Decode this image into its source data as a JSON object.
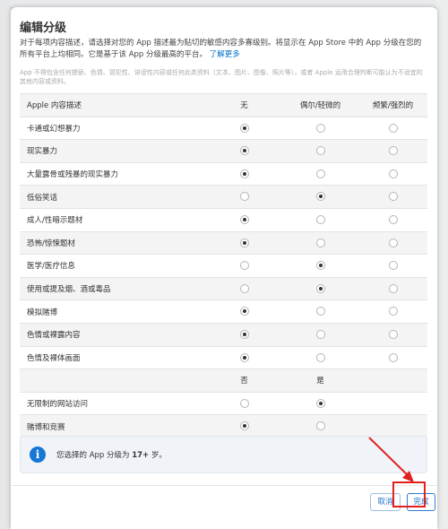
{
  "dialog": {
    "title": "编辑分级",
    "description": "对于每项内容描述，请选择对您的 App 描述最为贴切的敏感内容多寡级别。将显示在 App Store 中的 App 分级在您的所有平台上均相同。它是基于该 App 分级最高的平台。",
    "learn_more": "了解更多",
    "note": "App 不得包含任何猥亵、色情、冒犯性、诽谤性内容或任何此类资料（文本、图片、图像、照片等），或者 Apple 运用合理判断可能认为不适宜的其他内容或资料。"
  },
  "table1": {
    "headers": [
      "Apple 内容描述",
      "无",
      "偶尔/轻微的",
      "频繁/强烈的"
    ],
    "rows": [
      {
        "label": "卡通或幻想暴力",
        "selected": 0
      },
      {
        "label": "现实暴力",
        "selected": 0
      },
      {
        "label": "大量露骨或残暴的现实暴力",
        "selected": 0
      },
      {
        "label": "低俗笑话",
        "selected": 1
      },
      {
        "label": "成人/性暗示题材",
        "selected": 0
      },
      {
        "label": "恐怖/惊悚题材",
        "selected": 0
      },
      {
        "label": "医学/医疗信息",
        "selected": 1
      },
      {
        "label": "使用或提及烟、酒或毒品",
        "selected": 1
      },
      {
        "label": "模拟赌博",
        "selected": 0
      },
      {
        "label": "色情或裸露内容",
        "selected": 0
      },
      {
        "label": "色情及裸体画面",
        "selected": 0
      }
    ]
  },
  "table2": {
    "headers": [
      "",
      "否",
      "是"
    ],
    "rows": [
      {
        "label": "无限制的网站访问",
        "selected": 1
      },
      {
        "label": "赌博和竞赛",
        "selected": 0
      }
    ]
  },
  "info": {
    "icon": "info-icon",
    "prefix": "您选择的 App 分级为",
    "rating": "17+",
    "suffix": "岁。"
  },
  "buttons": {
    "cancel": "取消",
    "done": "完成"
  },
  "colors": {
    "accent": "#1677d6",
    "link": "#0070c9",
    "highlight": "#e32020"
  }
}
